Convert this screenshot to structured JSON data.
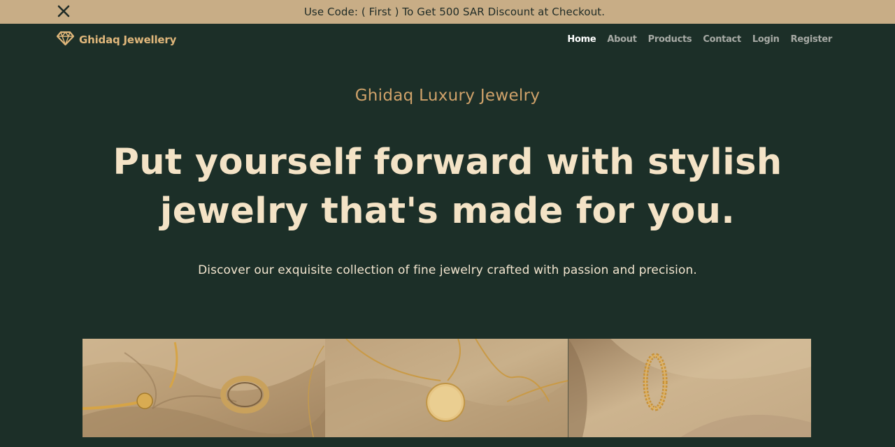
{
  "promo": {
    "text": "Use Code: ( First ) To Get 500 SAR Discount at Checkout.",
    "close_icon": "close-icon"
  },
  "nav": {
    "brand_name": "Ghidaq Jewellery",
    "brand_icon": "diamond-icon",
    "links": [
      {
        "label": "Home",
        "active": true
      },
      {
        "label": "About",
        "active": false
      },
      {
        "label": "Products",
        "active": false
      },
      {
        "label": "Contact",
        "active": false
      },
      {
        "label": "Login",
        "active": false
      },
      {
        "label": "Register",
        "active": false
      }
    ]
  },
  "hero": {
    "eyebrow": "Ghidaq Luxury Jewelry",
    "headline_line1": "Put yourself forward with stylish",
    "headline_line2": "jewelry that's made for you.",
    "subtitle": "Discover our exquisite collection of fine jewelry crafted with passion and precision."
  },
  "gallery": {
    "images": [
      "gold bracelet and ring on fabric",
      "gold coin pendant necklace on fabric",
      "twisted gold ring on fabric"
    ]
  },
  "colors": {
    "background": "#1c2f28",
    "promo_background": "#c8ad86",
    "brand_gold": "#e0b77b",
    "headline_cream": "#f4e3c6",
    "eyebrow_gold": "#cfa26a"
  }
}
